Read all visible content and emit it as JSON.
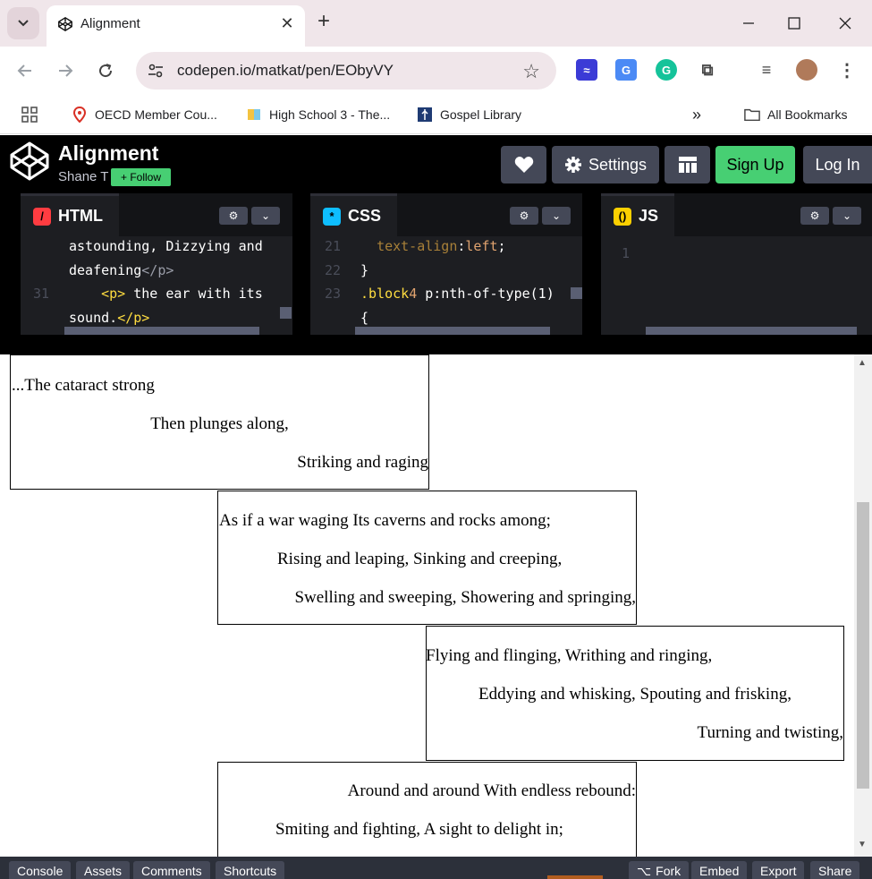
{
  "browser": {
    "tab_title": "Alignment",
    "url": "codepen.io/matkat/pen/EObyVY",
    "bookmarks": [
      {
        "label": "OECD Member Cou...",
        "icon": "map-pin-icon"
      },
      {
        "label": "High School 3 - The...",
        "icon": "book-icon"
      },
      {
        "label": "Gospel Library",
        "icon": "library-icon"
      }
    ],
    "all_bookmarks": "All Bookmarks"
  },
  "codepen": {
    "title": "Alignment",
    "author": "Shane T",
    "follow_label": "+ Follow",
    "settings_label": "Settings",
    "signup_label": "Sign Up",
    "login_label": "Log In",
    "accent": "#47cf73"
  },
  "editors": [
    {
      "name": "HTML",
      "badge_color": "#ff3c41",
      "lines": [
        {
          "num": "",
          "text": "astounding, Dizzying and"
        },
        {
          "num": "",
          "text": "deafening</p>"
        },
        {
          "num": "31",
          "text": "    <p> the ear with its"
        },
        {
          "num": "",
          "text": "sound.</p>"
        }
      ]
    },
    {
      "name": "CSS",
      "badge_color": "#0ebeff",
      "lines": [
        {
          "num": "21",
          "text": "  text-align:left;"
        },
        {
          "num": "22",
          "text": "}"
        },
        {
          "num": "23",
          "text": ".block4 p:nth-of-type(1)"
        },
        {
          "num": "",
          "text": "{"
        }
      ]
    },
    {
      "name": "JS",
      "badge_color": "#fcd000",
      "lines": [
        {
          "num": "1",
          "text": ""
        }
      ]
    }
  ],
  "preview": {
    "blocks": [
      {
        "lines": [
          "...The cataract strong",
          "Then plunges along,",
          "Striking and raging"
        ]
      },
      {
        "lines": [
          "As if a war waging Its caverns and rocks among;",
          "Rising and leaping, Sinking and creeping,",
          "Swelling and sweeping, Showering and springing,"
        ]
      },
      {
        "lines": [
          "Flying and flinging, Writhing and ringing,",
          "Eddying and whisking, Spouting and frisking,",
          "Turning and twisting,"
        ]
      },
      {
        "lines": [
          "Around and around With endless rebound:",
          "Smiting and fighting, A sight to delight in;"
        ]
      }
    ]
  },
  "bottom_bar": {
    "left": [
      "Console",
      "Assets",
      "Comments",
      "Shortcuts"
    ],
    "right": [
      "Fork",
      "Embed",
      "Export",
      "Share"
    ]
  }
}
